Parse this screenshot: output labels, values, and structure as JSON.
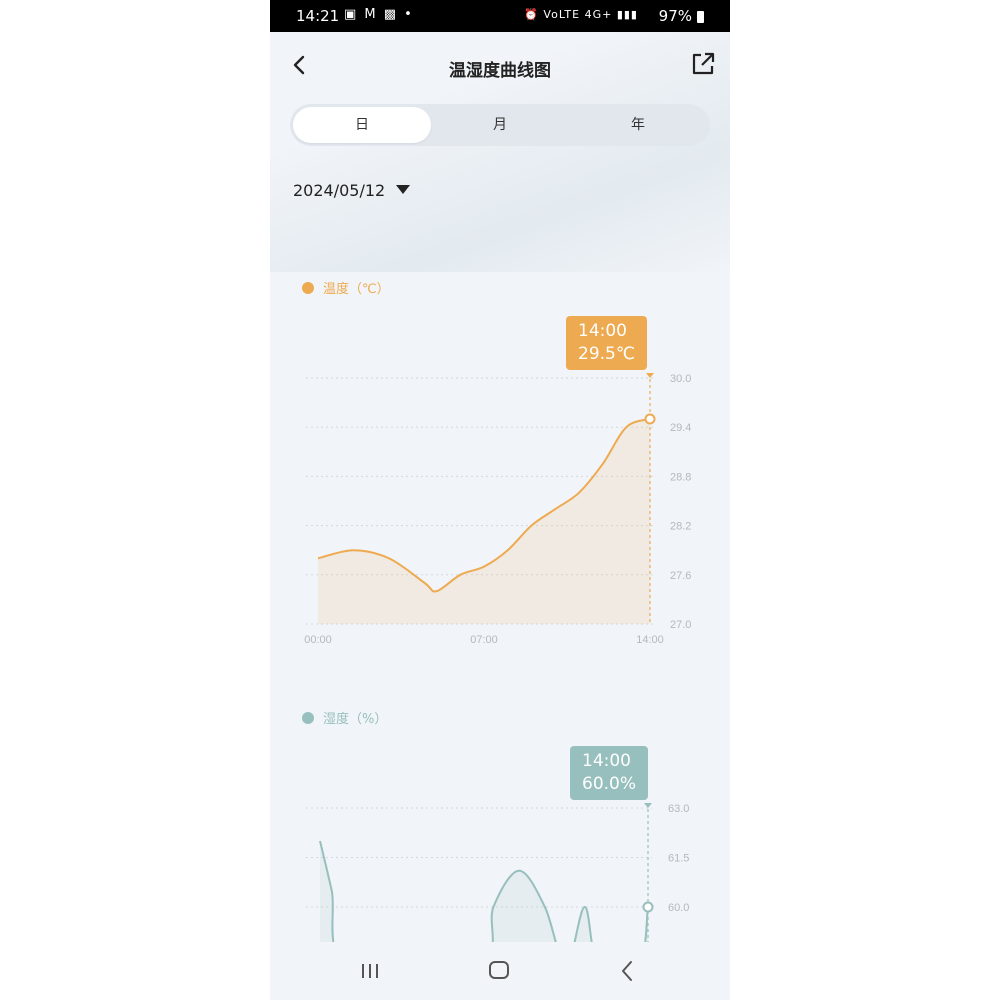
{
  "status_bar": {
    "time": "14:21",
    "notification_icons": "▣ M ▩ •",
    "system_icons": "⏰ VoLTE 4G+ ▮▮▮",
    "battery": "97%"
  },
  "header": {
    "title": "温湿度曲线图",
    "back_icon": "chevron-left-icon",
    "share_icon": "share-icon"
  },
  "tabs": [
    {
      "label": "日",
      "active": true
    },
    {
      "label": "月",
      "active": false
    },
    {
      "label": "年",
      "active": false
    }
  ],
  "date": "2024/05/12",
  "colors": {
    "temperature": "#eeaa50",
    "humidity": "#97bfbd",
    "grid": "#d4d9de",
    "tick": "#b4b9be"
  },
  "chart_data": [
    {
      "type": "area",
      "legend": "温度（℃）",
      "x_ticks": [
        "00:00",
        "07:00",
        "14:00"
      ],
      "y_ticks": [
        "30.0",
        "29.4",
        "28.8",
        "28.2",
        "27.6",
        "27.0"
      ],
      "ylim": [
        27.0,
        30.0
      ],
      "xlim": [
        0,
        14
      ],
      "x": [
        0,
        1.5,
        3,
        4.5,
        5,
        6,
        7,
        8,
        9,
        10,
        11,
        12,
        13,
        14
      ],
      "values": [
        27.8,
        27.9,
        27.8,
        27.5,
        27.4,
        27.6,
        27.7,
        27.9,
        28.2,
        28.4,
        28.6,
        28.95,
        29.4,
        29.5
      ],
      "tooltip": {
        "time": "14:00",
        "value": "29.5℃"
      }
    },
    {
      "type": "area",
      "legend": "湿度（%）",
      "y_ticks": [
        "63.0",
        "61.5",
        "60.0"
      ],
      "ylim": [
        57.5,
        63.0
      ],
      "xlim": [
        0,
        14
      ],
      "x": [
        0,
        0.5,
        1.2,
        6.8,
        7.4,
        8.5,
        9.6,
        10.5,
        11.3,
        11.9,
        13.6,
        14
      ],
      "values": [
        62.0,
        60.5,
        58.2,
        58.2,
        60.0,
        61.1,
        60.0,
        58.2,
        60.0,
        58.2,
        58.2,
        60.0
      ],
      "tooltip": {
        "time": "14:00",
        "value": "60.0%"
      }
    }
  ]
}
